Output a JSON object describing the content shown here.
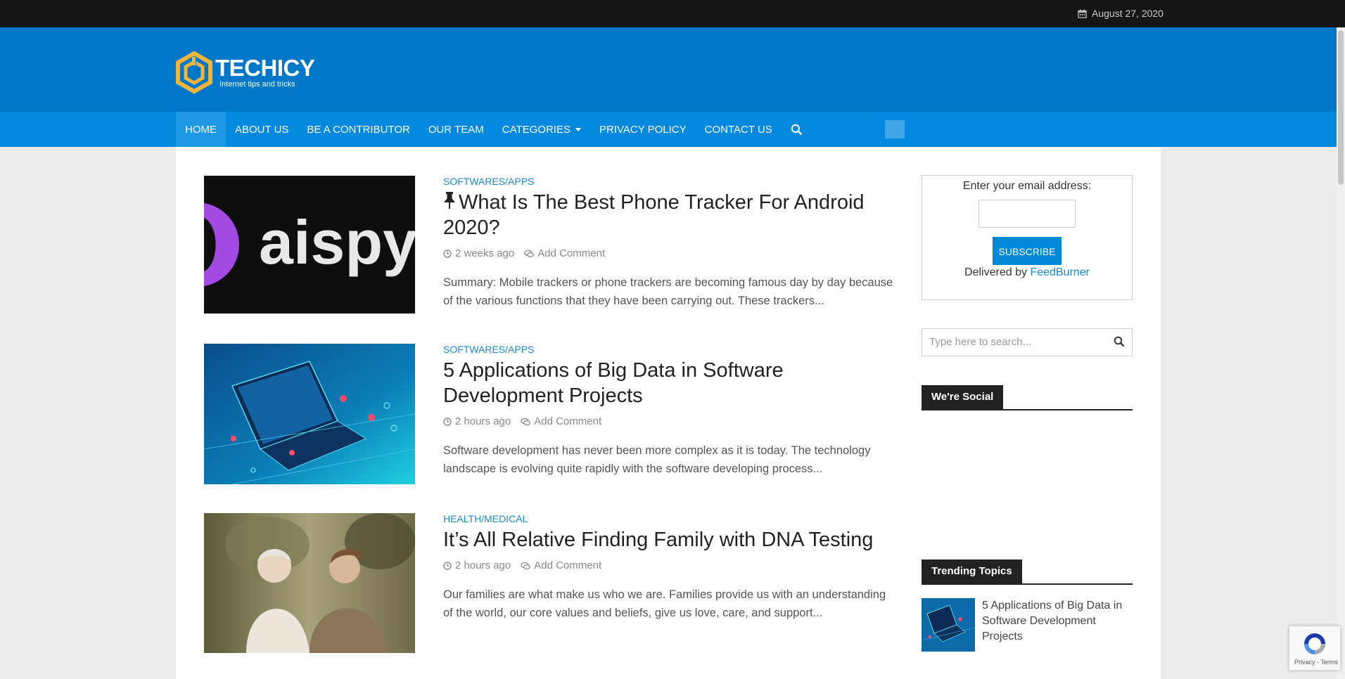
{
  "topbar": {
    "date": "August 27, 2020"
  },
  "brand": {
    "name": "TECHICY",
    "tagline": "Internet tips and tricks"
  },
  "nav": {
    "items": [
      "HOME",
      "ABOUT US",
      "BE A CONTRIBUTOR",
      "OUR TEAM",
      "CATEGORIES",
      "PRIVACY POLICY",
      "CONTACT US"
    ]
  },
  "posts": [
    {
      "category": "SOFTWARES/APPS",
      "title": "What Is The Best Phone Tracker For Android 2020?",
      "time": "2 weeks ago",
      "comment": "Add Comment",
      "excerpt": "Summary:  Mobile trackers or phone trackers are becoming famous day by day because of the various functions that they have been carrying out. These trackers...",
      "thumb_text": "aispy"
    },
    {
      "category": "SOFTWARES/APPS",
      "title": "5 Applications of Big Data in Software Development Projects",
      "time": "2 hours ago",
      "comment": "Add Comment",
      "excerpt": "Software development has never been more complex as it is today. The technology landscape is evolving quite rapidly with the software developing process..."
    },
    {
      "category": "HEALTH/MEDICAL",
      "title": "It’s All Relative Finding Family with DNA Testing",
      "time": "2 hours ago",
      "comment": "Add Comment",
      "excerpt": "Our families are what make us who we are. Families provide us with an understanding of the world, our core values and beliefs, give us love, care, and support..."
    }
  ],
  "sidebar": {
    "subscribe": {
      "label": "Enter your email address:",
      "button": "SUBSCRIBE",
      "delivered": "Delivered by",
      "feedburner": "FeedBurner"
    },
    "search": {
      "placeholder": "Type here to search..."
    },
    "social_title": "We're Social",
    "trending_title": "Trending Topics",
    "trending": [
      {
        "title": "5 Applications of Big Data in Software Development Projects"
      }
    ]
  },
  "recaptcha": {
    "text": "Privacy - Terms"
  },
  "colors": {
    "header": "#0077c8",
    "nav": "#0089df",
    "accent": "#1a8ad6"
  }
}
